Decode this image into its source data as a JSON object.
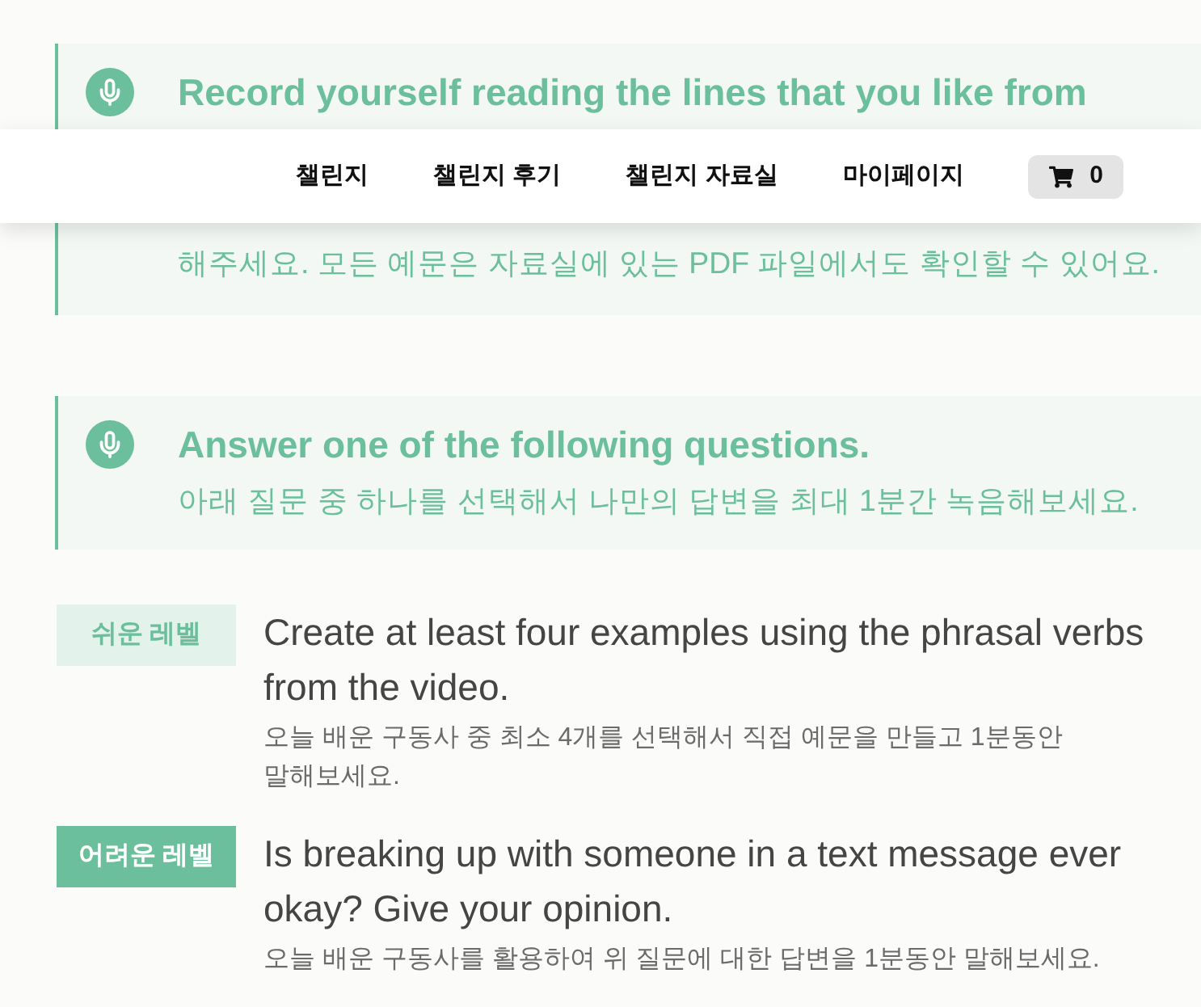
{
  "nav": {
    "links": [
      {
        "label": "챌린지"
      },
      {
        "label": "챌린지 후기"
      },
      {
        "label": "챌린지 자료실"
      },
      {
        "label": "마이페이지"
      }
    ],
    "cart": {
      "count": "0"
    }
  },
  "prompts": [
    {
      "title": "Record yourself reading the lines that you like from",
      "subtitle": "해주세요. 모든 예문은 자료실에 있는 PDF 파일에서도 확인할 수 있어요."
    },
    {
      "title": "Answer one of the following questions.",
      "subtitle": "아래 질문 중 하나를 선택해서 나만의 답변을 최대 1분간 녹음해보세요."
    }
  ],
  "questions": [
    {
      "kind": "easy",
      "badge": "쉬운 레벨",
      "title": "Create at least four examples using the phrasal verbs from the video.",
      "description": "오늘 배운 구동사 중 최소 4개를 선택해서 직접 예문을 만들고 1분동안 말해보세요."
    },
    {
      "kind": "hard",
      "badge": "어려운 레벨",
      "title": "Is breaking up with someone in a text message ever okay? Give your opinion.",
      "description": "오늘 배운 구동사를 활용하여 위 질문에 대한 답변을 1분동안 말해보세요."
    }
  ]
}
